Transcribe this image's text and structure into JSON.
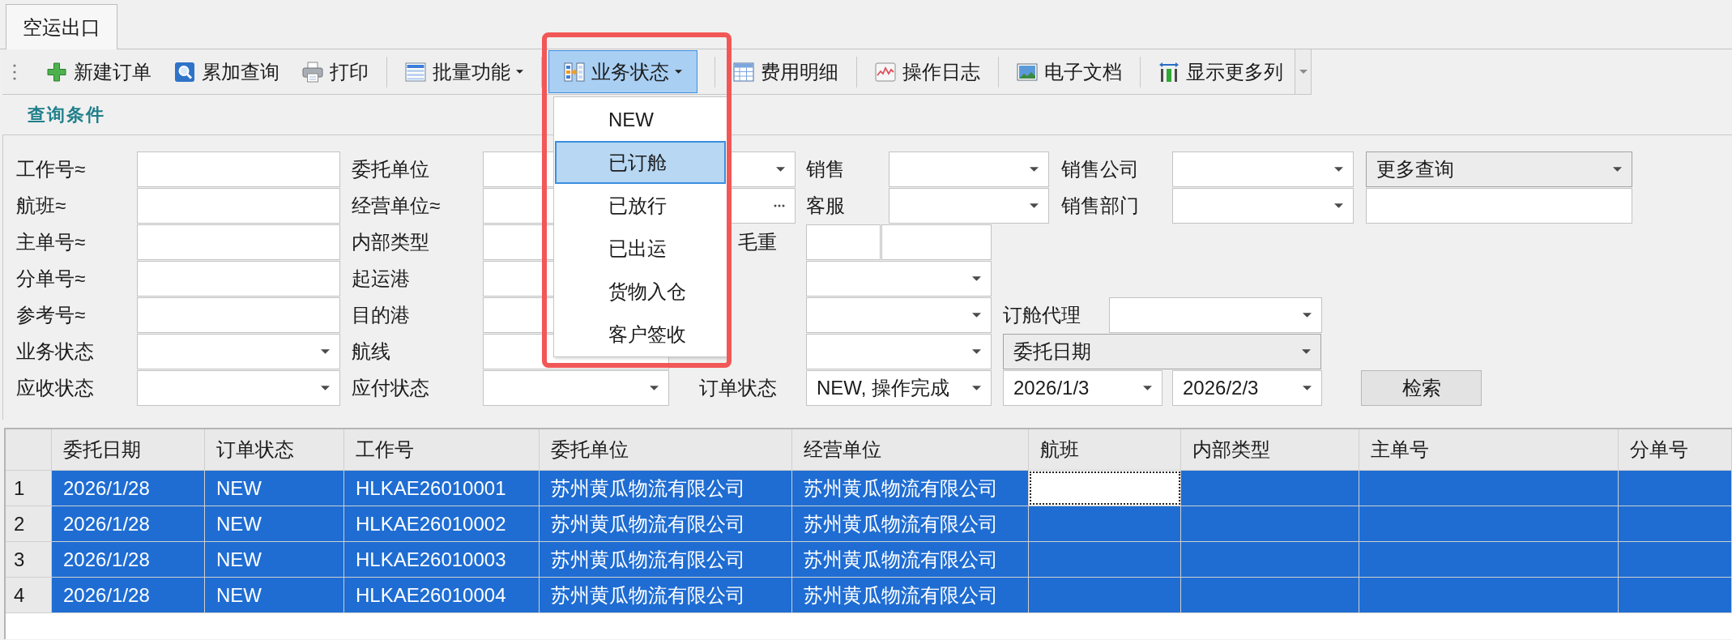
{
  "tabs": [
    {
      "label": "空运出口",
      "selected": true
    }
  ],
  "toolbar": {
    "groups": [
      [
        {
          "kind": "button",
          "label": "新建订单",
          "pressed": false,
          "highlighted": false
        },
        {
          "kind": "button",
          "label": "累加查询",
          "pressed": false,
          "highlighted": false
        },
        {
          "kind": "button",
          "label": "打印",
          "pressed": false,
          "highlighted": false
        }
      ],
      [
        {
          "kind": "dropdown",
          "label": "批量功能",
          "pressed": false,
          "highlighted": false
        }
      ],
      [
        {
          "kind": "dropdown",
          "label": "业务状态",
          "pressed": true,
          "highlighted": true,
          "menu": [
            {
              "label": "NEW",
              "selected": false
            },
            {
              "label": "已订舱",
              "selected": true
            },
            {
              "label": "已放行",
              "selected": false
            },
            {
              "label": "已出运",
              "selected": false
            },
            {
              "label": "货物入仓",
              "selected": false
            },
            {
              "label": "客户签收",
              "selected": false
            }
          ]
        }
      ],
      [
        {
          "kind": "button",
          "label": "费用明细",
          "pressed": false,
          "highlighted": false
        }
      ],
      [
        {
          "kind": "button",
          "label": "操作日志",
          "pressed": false,
          "highlighted": false
        }
      ],
      [
        {
          "kind": "button",
          "label": "电子文档",
          "pressed": false,
          "highlighted": false
        }
      ],
      [
        {
          "kind": "button",
          "label": "显示更多列",
          "pressed": false,
          "highlighted": false
        }
      ]
    ]
  },
  "query_panel": {
    "title": "查询条件",
    "rows": [
      [
        {
          "label": "工作号≈",
          "kind": "text"
        },
        {
          "label": "委托单位",
          "kind": "combo"
        },
        {
          "label": "销售",
          "kind": "combo"
        },
        {
          "label": "销售公司",
          "kind": "combo"
        },
        {
          "kind": "list",
          "value": "更多查询"
        }
      ],
      [
        {
          "label": "航班≈",
          "kind": "text"
        },
        {
          "label": "经营单位≈",
          "kind": "lookup"
        },
        {
          "label": "客服",
          "kind": "combo"
        },
        {
          "label": "销售部门",
          "kind": "combo"
        },
        {
          "kind": "text"
        }
      ],
      [
        {
          "label": "主单号≈",
          "kind": "text"
        },
        {
          "label": "内部类型",
          "kind": "text"
        },
        {
          "label": "毛重",
          "kind": "pair"
        }
      ],
      [
        {
          "label": "分单号≈",
          "kind": "text"
        },
        {
          "label": "起运港",
          "kind": "text"
        },
        {
          "kind": "combo"
        }
      ],
      [
        {
          "label": "参考号≈",
          "kind": "text"
        },
        {
          "label": "目的港",
          "kind": "text"
        },
        {
          "kind": "combo"
        },
        {
          "label": "订舱代理",
          "kind": "combo"
        }
      ],
      [
        {
          "label": "业务状态",
          "kind": "combo"
        },
        {
          "label": "航线",
          "kind": "text"
        },
        {
          "kind": "combo"
        },
        {
          "kind": "list",
          "value": "委托日期"
        }
      ],
      [
        {
          "label": "应收状态",
          "kind": "combo"
        },
        {
          "label": "应付状态",
          "kind": "combo"
        },
        {
          "label": "订单状态",
          "kind": "combo",
          "value": "NEW, 操作完成"
        },
        {
          "kind": "date-range",
          "from": "2026/1/3",
          "to": "2026/2/3"
        },
        {
          "kind": "button",
          "label": "检索"
        }
      ]
    ]
  },
  "table": {
    "columns": [
      "委托日期",
      "订单状态",
      "工作号",
      "委托单位",
      "经营单位",
      "航班",
      "内部类型",
      "主单号",
      "分单号"
    ],
    "rows": [
      {
        "number": "1",
        "selected": true,
        "cells": [
          {
            "text": "2026/1/28",
            "focused": false
          },
          {
            "text": "NEW",
            "focused": false
          },
          {
            "text": "HLKAE26010001",
            "focused": false
          },
          {
            "text": "苏州黄瓜物流有限公司",
            "focused": false
          },
          {
            "text": "苏州黄瓜物流有限公司",
            "focused": false
          },
          {
            "focused": true
          },
          {
            "focused": false
          },
          {
            "focused": false
          },
          {
            "focused": false
          }
        ]
      },
      {
        "number": "2",
        "selected": true,
        "cells": [
          {
            "text": "2026/1/28",
            "focused": false
          },
          {
            "text": "NEW",
            "focused": false
          },
          {
            "text": "HLKAE26010002",
            "focused": false
          },
          {
            "text": "苏州黄瓜物流有限公司",
            "focused": false
          },
          {
            "text": "苏州黄瓜物流有限公司",
            "focused": false
          },
          {
            "focused": false
          },
          {
            "focused": false
          },
          {
            "focused": false
          },
          {
            "focused": false
          }
        ]
      },
      {
        "number": "3",
        "selected": true,
        "cells": [
          {
            "text": "2026/1/28",
            "focused": false
          },
          {
            "text": "NEW",
            "focused": false
          },
          {
            "text": "HLKAE26010003",
            "focused": false
          },
          {
            "text": "苏州黄瓜物流有限公司",
            "focused": false
          },
          {
            "text": "苏州黄瓜物流有限公司",
            "focused": false
          },
          {
            "focused": false
          },
          {
            "focused": false
          },
          {
            "focused": false
          },
          {
            "focused": false
          }
        ]
      },
      {
        "number": "4",
        "selected": true,
        "cells": [
          {
            "text": "2026/1/28",
            "focused": false
          },
          {
            "text": "NEW",
            "focused": false
          },
          {
            "text": "HLKAE26010004",
            "focused": false
          },
          {
            "text": "苏州黄瓜物流有限公司",
            "focused": false
          },
          {
            "text": "苏州黄瓜物流有限公司",
            "focused": false
          },
          {
            "focused": false
          },
          {
            "focused": false
          },
          {
            "focused": false
          },
          {
            "focused": false
          }
        ]
      }
    ]
  }
}
